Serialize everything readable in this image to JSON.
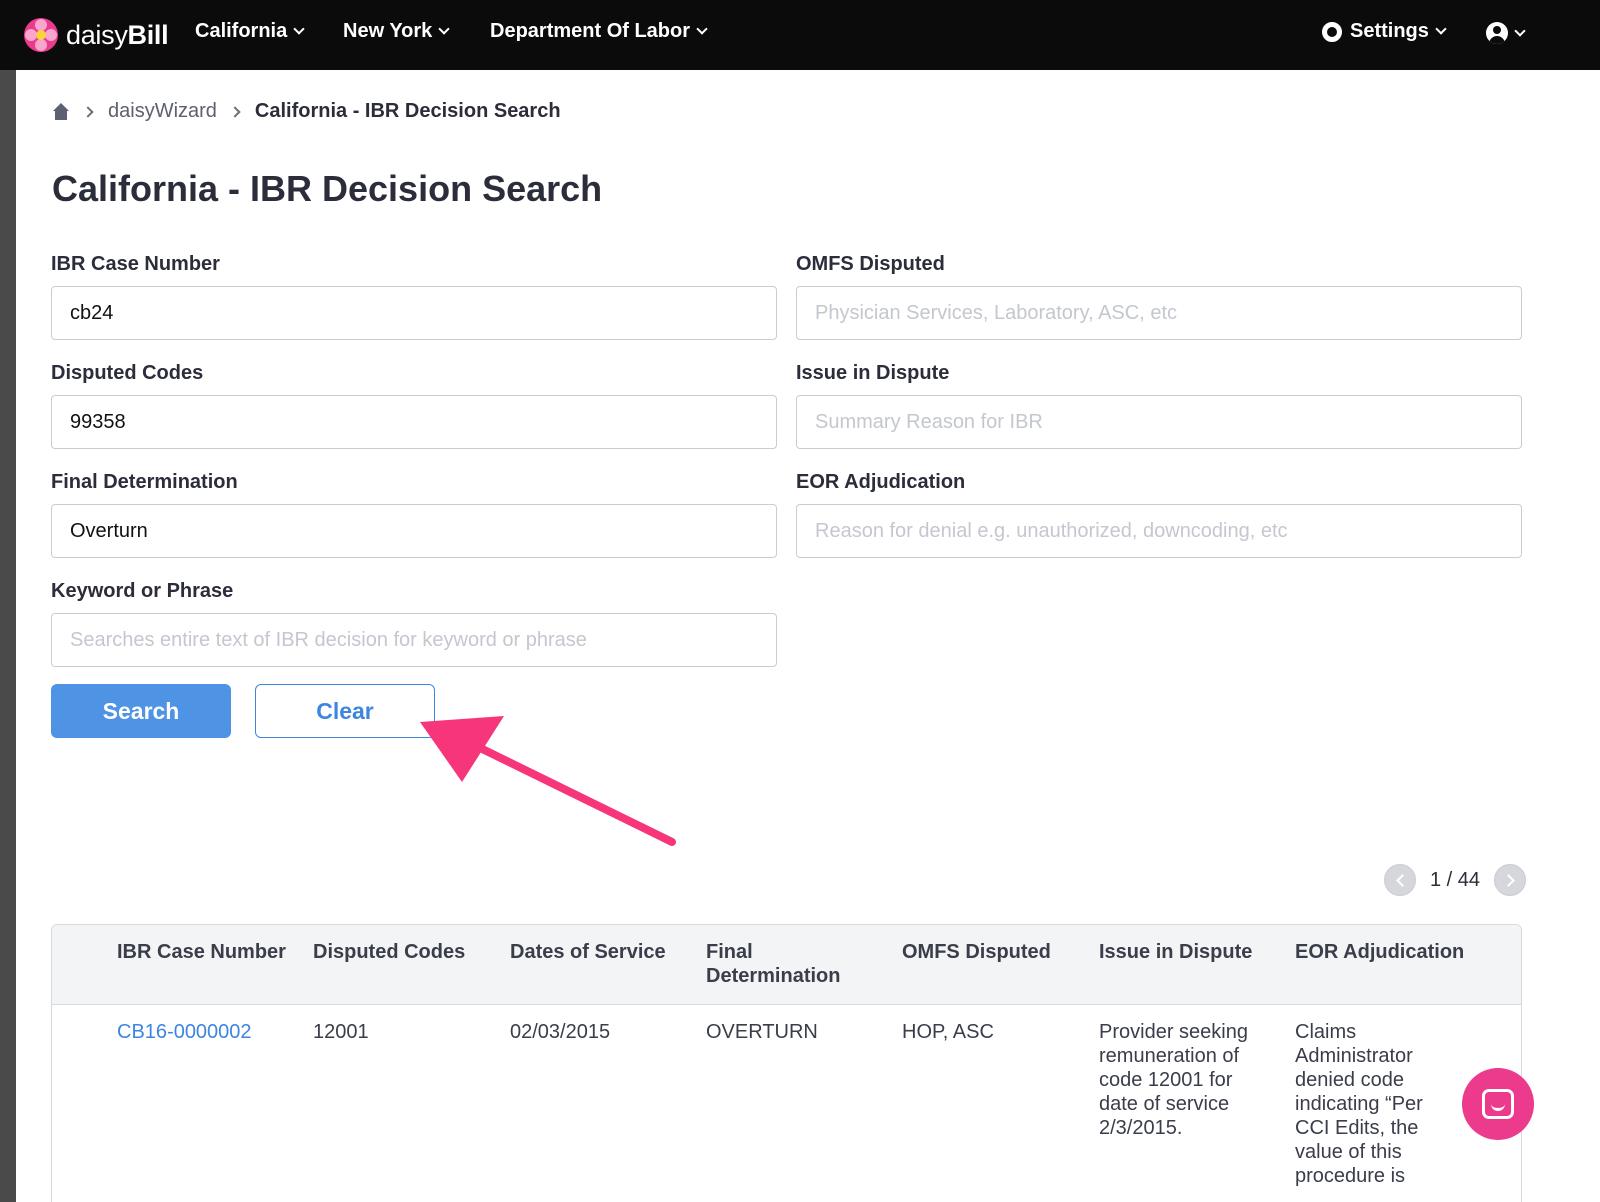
{
  "nav": {
    "brand_light": "daisy",
    "brand_bold": "Bill",
    "items": [
      "California",
      "New York",
      "Department Of Labor"
    ],
    "settings_label": "Settings"
  },
  "breadcrumb": {
    "items": [
      "daisyWizard",
      "California - IBR Decision Search"
    ]
  },
  "page_title": "California - IBR Decision Search",
  "form": {
    "ibr_case_number": {
      "label": "IBR Case Number",
      "value": "cb24",
      "placeholder": ""
    },
    "omfs_disputed": {
      "label": "OMFS Disputed",
      "value": "",
      "placeholder": "Physician Services, Laboratory, ASC, etc"
    },
    "disputed_codes": {
      "label": "Disputed Codes",
      "value": "99358",
      "placeholder": ""
    },
    "issue_in_dispute": {
      "label": "Issue in Dispute",
      "value": "",
      "placeholder": "Summary Reason for IBR"
    },
    "final_determination": {
      "label": "Final Determination",
      "value": "Overturn",
      "placeholder": ""
    },
    "eor_adjudication": {
      "label": "EOR Adjudication",
      "value": "",
      "placeholder": "Reason for denial e.g. unauthorized, downcoding, etc"
    },
    "keyword": {
      "label": "Keyword or Phrase",
      "value": "",
      "placeholder": "Searches entire text of IBR decision for keyword or phrase"
    },
    "search_label": "Search",
    "clear_label": "Clear"
  },
  "pagination": {
    "text": "1 / 44"
  },
  "table": {
    "headers": [
      "IBR Case Number",
      "Disputed Codes",
      "Dates of Service",
      "Final Determination",
      "OMFS Disputed",
      "Issue in Dispute",
      "EOR Adjudication"
    ],
    "rows": [
      [
        "CB16-0000002",
        "12001",
        "02/03/2015",
        "OVERTURN",
        "HOP, ASC",
        "Provider seeking remuneration of code 12001 for date of service 2/3/2015.",
        "Claims Administrator denied code indicating “Per CCI Edits, the value of this procedure is"
      ]
    ]
  },
  "colors": {
    "accent": "#4e93e4",
    "brand": "#ec3a8c",
    "annotation_arrow": "#f7357a"
  }
}
